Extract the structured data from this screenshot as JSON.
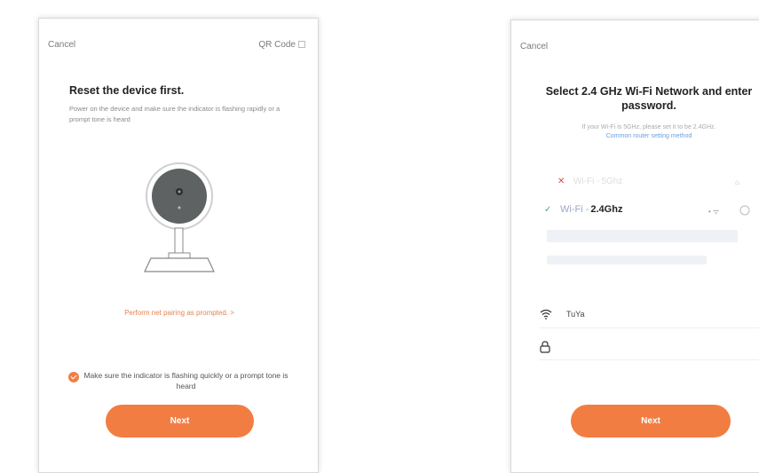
{
  "left_screen": {
    "cancel_label": "Cancel",
    "qr_label": "QR Code",
    "title": "Reset the device first.",
    "description": "Power on the device and make sure the indicator is flashing rapidly or a prompt tone is heard",
    "prompt_link": "Perform net pairing as prompted. >",
    "confirm_text": "Make sure the indicator is flashing quickly or a prompt tone is heard",
    "next_label": "Next"
  },
  "right_screen": {
    "cancel_label": "Cancel",
    "title": "Select 2.4 GHz Wi-Fi Network and enter password.",
    "hint": "If your Wi-Fi is 5GHz, please set it to be 2.4GHz.",
    "hint_link": "Common router setting method",
    "networks": [
      {
        "mark": "✕",
        "name_prefix": "Wi-Fi - ",
        "band": "5Ghz",
        "status_color": "#e24a3b"
      },
      {
        "mark": "✓",
        "name_prefix": "Wi-Fi - ",
        "band": "2.4Ghz",
        "status_color": "#49b07a"
      }
    ],
    "wifi_value": "TuYa",
    "next_label": "Next"
  },
  "colors": {
    "accent": "#f27d42",
    "link": "#6aa0de"
  }
}
